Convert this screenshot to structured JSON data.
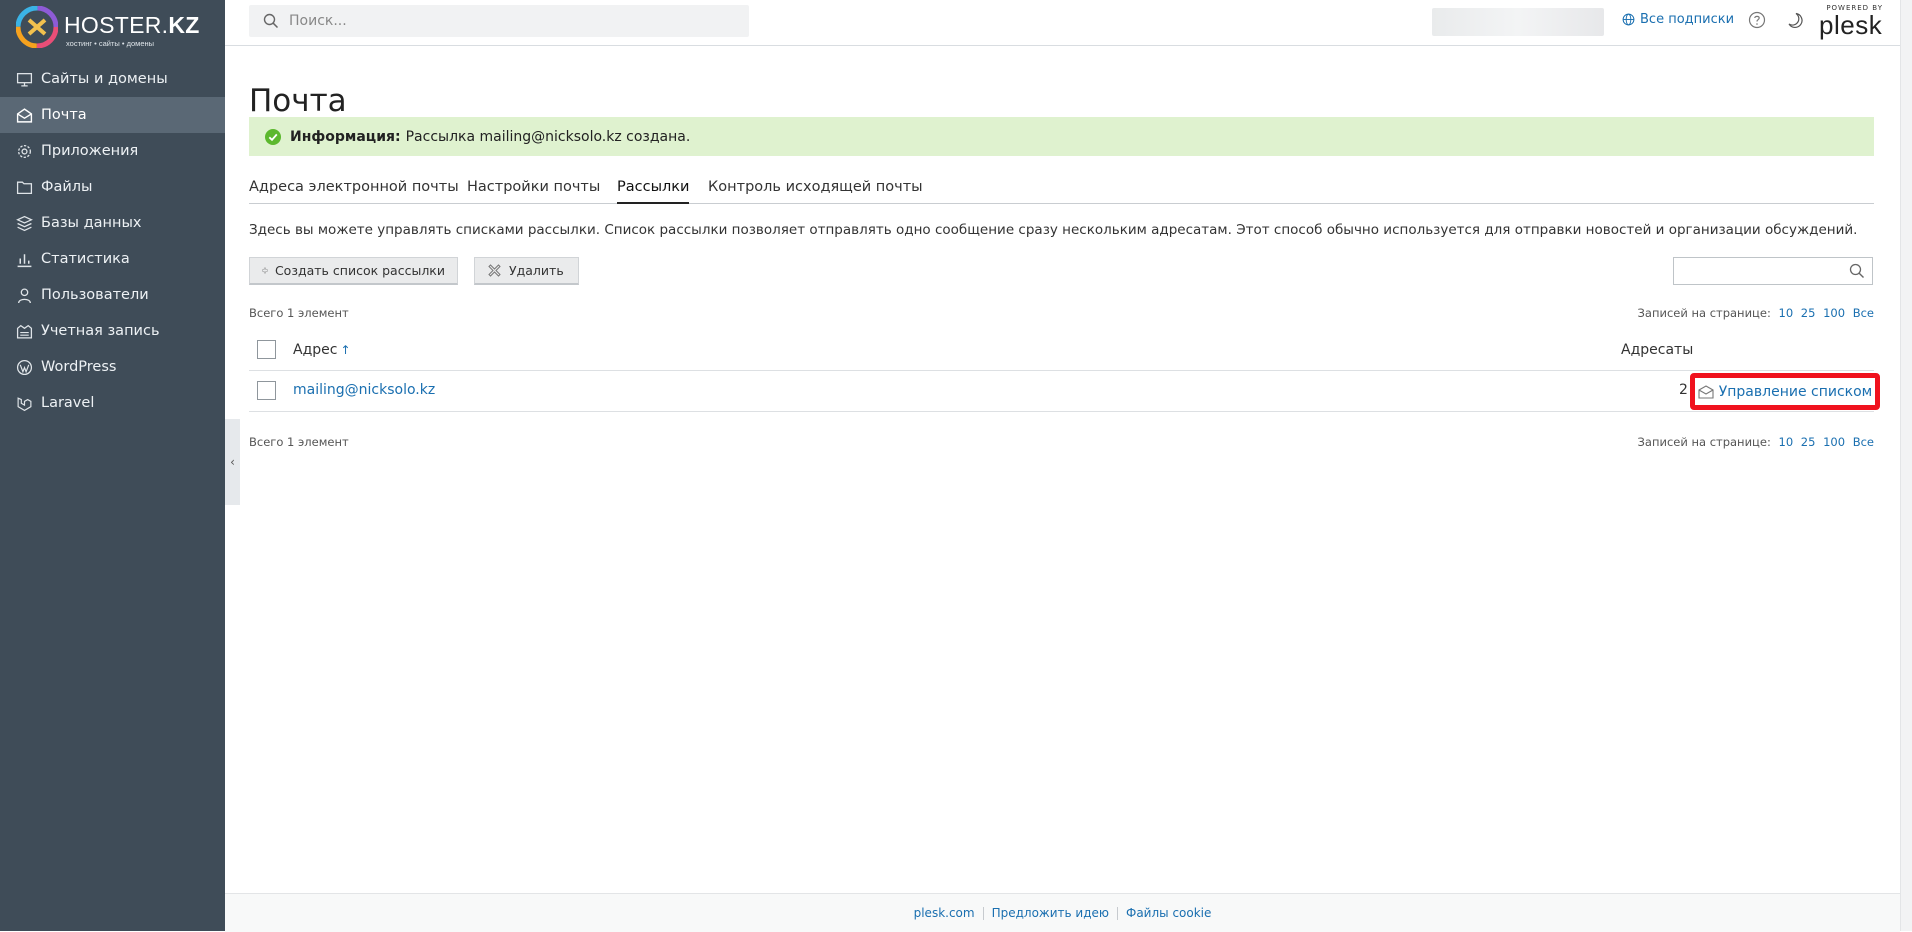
{
  "brand": {
    "name_light": "HOSTER.",
    "name_bold": "KZ",
    "tagline": "хостинг • сайты • домены",
    "colors": {
      "sidebar": "#3f4c58",
      "link": "#1a6fb0",
      "highlight": "#f0121e",
      "info_bg": "#dff2cf"
    }
  },
  "sidebar": {
    "items": [
      {
        "label": "Сайты и домены",
        "icon": "monitor-icon"
      },
      {
        "label": "Почта",
        "icon": "mail-icon",
        "active": true
      },
      {
        "label": "Приложения",
        "icon": "gear-icon"
      },
      {
        "label": "Файлы",
        "icon": "folder-icon"
      },
      {
        "label": "Базы данных",
        "icon": "database-icon"
      },
      {
        "label": "Статистика",
        "icon": "bar-chart-icon"
      },
      {
        "label": "Пользователи",
        "icon": "user-icon"
      },
      {
        "label": "Учетная запись",
        "icon": "account-icon"
      },
      {
        "label": "WordPress",
        "icon": "wordpress-icon"
      },
      {
        "label": "Laravel",
        "icon": "laravel-icon"
      }
    ]
  },
  "topbar": {
    "search_placeholder": "Поиск...",
    "subscriptions_label": "Все подписки",
    "powered_by": "POWERED BY",
    "plesk": "plesk"
  },
  "page": {
    "title": "Почта",
    "info_label": "Информация:",
    "info_text": "Рассылка mailing@nicksolo.kz создана.",
    "tabs": [
      {
        "label": "Адреса электронной почты"
      },
      {
        "label": "Настройки почты"
      },
      {
        "label": "Рассылки",
        "active": true
      },
      {
        "label": "Контроль исходящей почты"
      }
    ],
    "description": "Здесь вы можете управлять списками рассылки. Список рассылки позволяет отправлять одно сообщение сразу нескольким адресатам. Этот способ обычно используется для отправки новостей и организации обсуждений.",
    "toolbar": {
      "create_label": "Создать список рассылки",
      "delete_label": "Удалить"
    },
    "total_label": "Всего 1 элемент",
    "per_page_label": "Записей на странице:",
    "per_page_options": [
      "10",
      "25",
      "100",
      "Все"
    ],
    "table": {
      "col_address": "Адрес",
      "sort_arrow": "↑",
      "col_recipients": "Адресаты",
      "rows": [
        {
          "address": "mailing@nicksolo.kz",
          "recipients": "2",
          "action": "Управление списком"
        }
      ]
    }
  },
  "footer": {
    "links": [
      "plesk.com",
      "Предложить идею",
      "Файлы cookie"
    ]
  }
}
